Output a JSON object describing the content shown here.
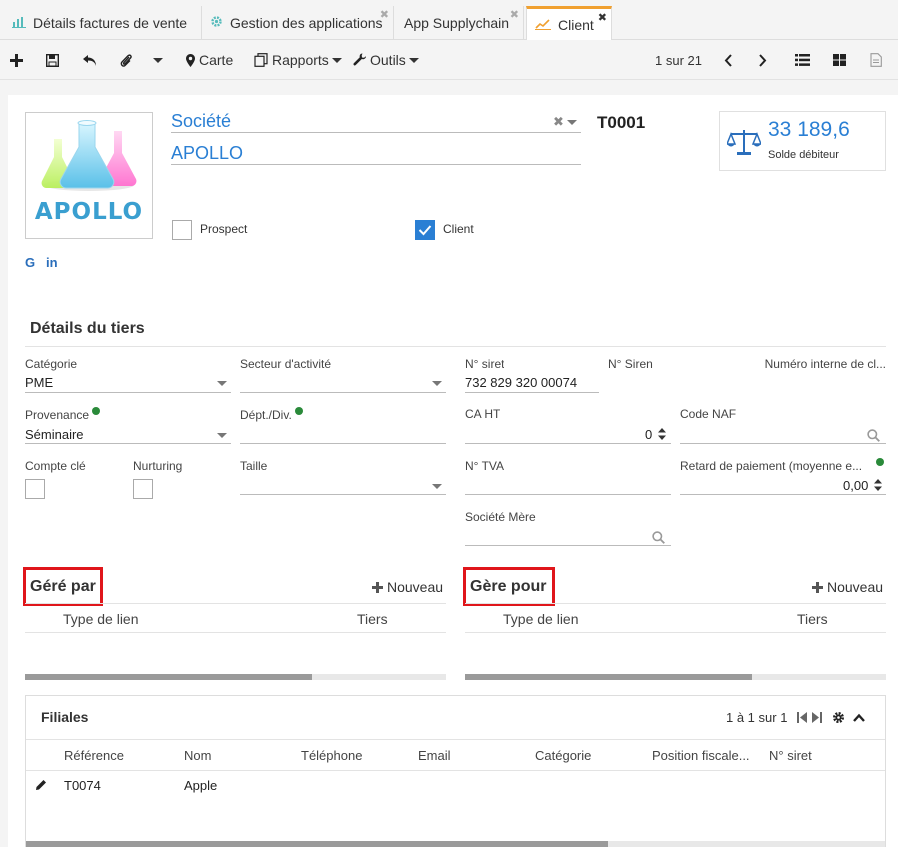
{
  "tabs": [
    {
      "label": "Détails factures de vente",
      "icon": "bar-chart-icon",
      "closable": false
    },
    {
      "label": "Gestion des applications",
      "icon": "gear-icon",
      "closable": true
    },
    {
      "label": "App Supplychain",
      "icon": "",
      "closable": true
    },
    {
      "label": "Client",
      "icon": "line-chart-icon",
      "closable": true,
      "active": true
    }
  ],
  "toolbar": {
    "carte_label": "Carte",
    "rapports_label": "Rapports",
    "outils_label": "Outils",
    "pager": "1 sur 21"
  },
  "header": {
    "societe_label": "Société",
    "name": "APOLLO",
    "code": "T0001",
    "logo_text": "APOLLO",
    "balance_value": "33 189,6",
    "balance_label": "Solde débiteur",
    "prospect_label": "Prospect",
    "prospect_checked": false,
    "client_label": "Client",
    "client_checked": true,
    "social": [
      "G",
      "in"
    ]
  },
  "details": {
    "title": "Détails du tiers",
    "categorie_label": "Catégorie",
    "categorie_value": "PME",
    "secteur_label": "Secteur d'activité",
    "siret_label": "N° siret",
    "siret_value": "732 829 320 00074",
    "siren_label": "N° Siren",
    "num_interne_label": "Numéro interne de cl...",
    "provenance_label": "Provenance",
    "provenance_value": "Séminaire",
    "dept_label": "Dépt./Div.",
    "ca_label": "CA HT",
    "ca_value": "0",
    "naf_label": "Code NAF",
    "compte_cle_label": "Compte clé",
    "nurturing_label": "Nurturing",
    "taille_label": "Taille",
    "tva_label": "N° TVA",
    "retard_label": "Retard de paiement (moyenne e...",
    "retard_value": "0,00",
    "societe_mere_label": "Société Mère"
  },
  "gere_par": {
    "title": "Géré par",
    "nouveau": "Nouveau",
    "col_type": "Type de lien",
    "col_tiers": "Tiers"
  },
  "gere_pour": {
    "title": "Gère pour",
    "nouveau": "Nouveau",
    "col_type": "Type de lien",
    "col_tiers": "Tiers"
  },
  "filiales": {
    "title": "Filiales",
    "pager": "1 à 1 sur 1",
    "columns": [
      "Référence",
      "Nom",
      "Téléphone",
      "Email",
      "Catégorie",
      "Position fiscale...",
      "N° siret"
    ],
    "rows": [
      {
        "reference": "T0074",
        "nom": "Apple"
      }
    ]
  },
  "colors": {
    "accent_blue": "#2a7fd4",
    "highlight_red": "#e0161b",
    "active_tab_border": "#f0a030"
  }
}
